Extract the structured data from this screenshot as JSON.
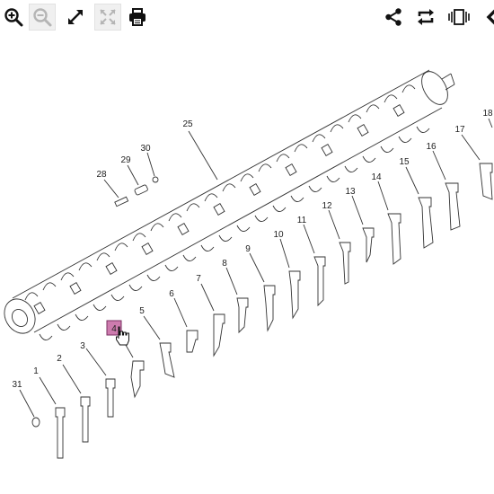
{
  "toolbar": {
    "left": [
      {
        "id": "zoom-in",
        "icon": "zoom-in-icon",
        "enabled": true
      },
      {
        "id": "zoom-out",
        "icon": "zoom-out-icon",
        "enabled": false
      },
      {
        "id": "expand",
        "icon": "expand-arrows-icon",
        "enabled": true
      },
      {
        "id": "fit",
        "icon": "fit-screen-icon",
        "enabled": false
      },
      {
        "id": "print",
        "icon": "printer-icon",
        "enabled": true
      }
    ],
    "right": [
      {
        "id": "share",
        "icon": "share-icon",
        "enabled": true
      },
      {
        "id": "rotate",
        "icon": "rotate-icon",
        "enabled": true
      },
      {
        "id": "carousel",
        "icon": "carousel-icon",
        "enabled": true
      },
      {
        "id": "next",
        "icon": "chevron-left-icon",
        "enabled": true
      }
    ]
  },
  "diagram": {
    "callouts": {
      "c1": "1",
      "c2": "2",
      "c3": "3",
      "c4": "4",
      "c5": "5",
      "c6": "6",
      "c7": "7",
      "c8": "8",
      "c9": "9",
      "c10": "10",
      "c11": "11",
      "c12": "12",
      "c13": "13",
      "c14": "14",
      "c15": "15",
      "c16": "16",
      "c17": "17",
      "c18": "18",
      "c25": "25",
      "c28": "28",
      "c29": "29",
      "c30": "30",
      "c31": "31"
    },
    "highlighted_callout": "4",
    "highlight_color": "#c05a9a"
  }
}
